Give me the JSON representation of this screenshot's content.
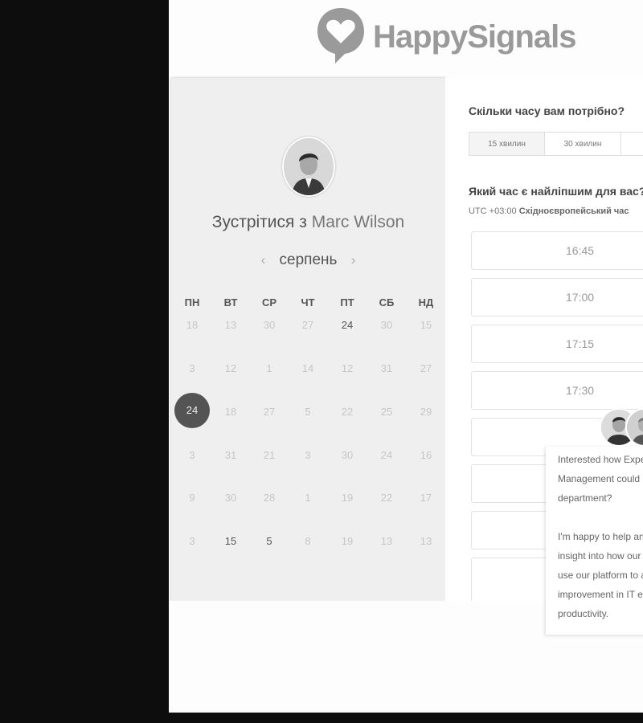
{
  "brand": {
    "name": "HappySignals"
  },
  "meeting": {
    "title_prefix": "Зустрітися з",
    "host_name": "Marc Wilson",
    "month": "серпень",
    "prev_arrow": "‹",
    "next_arrow": "›"
  },
  "calendar": {
    "weekdays": [
      "ПН",
      "ВТ",
      "СР",
      "ЧТ",
      "ПТ",
      "СБ",
      "НД"
    ],
    "rows": [
      [
        "18",
        "13",
        "30",
        "27",
        "24",
        "30",
        "15"
      ],
      [
        "3",
        "12",
        "1",
        "14",
        "12",
        "31",
        "27"
      ],
      [
        "24",
        "18",
        "27",
        "5",
        "22",
        "25",
        "29"
      ],
      [
        "3",
        "31",
        "21",
        "3",
        "30",
        "24",
        "16"
      ],
      [
        "9",
        "30",
        "28",
        "1",
        "19",
        "22",
        "17"
      ],
      [
        "3",
        "15",
        "5",
        "8",
        "19",
        "13",
        "13"
      ]
    ],
    "active_cells": [
      [
        0,
        4
      ],
      [
        5,
        1
      ],
      [
        5,
        2
      ]
    ],
    "selected_cell": [
      2,
      0
    ]
  },
  "booking": {
    "duration_question": "Скільки часу вам потрібно?",
    "durations": [
      "15 хвилин",
      "30 хвилин"
    ],
    "selected_duration": "15 хвилин",
    "time_question": "Який час є найліпшим для вас?",
    "timezone_offset": "UTC +03:00",
    "timezone_name": "Східноєвропейський час",
    "slots": [
      "16:45",
      "17:00",
      "17:15",
      "17:30",
      "",
      "",
      ""
    ]
  },
  "chat": {
    "lines": [
      "Interested how Expe",
      "Management could",
      "department?",
      "",
      "I'm happy to help an",
      "insight into how our",
      "use our platform to a",
      "improvement in IT e",
      "productivity."
    ]
  }
}
